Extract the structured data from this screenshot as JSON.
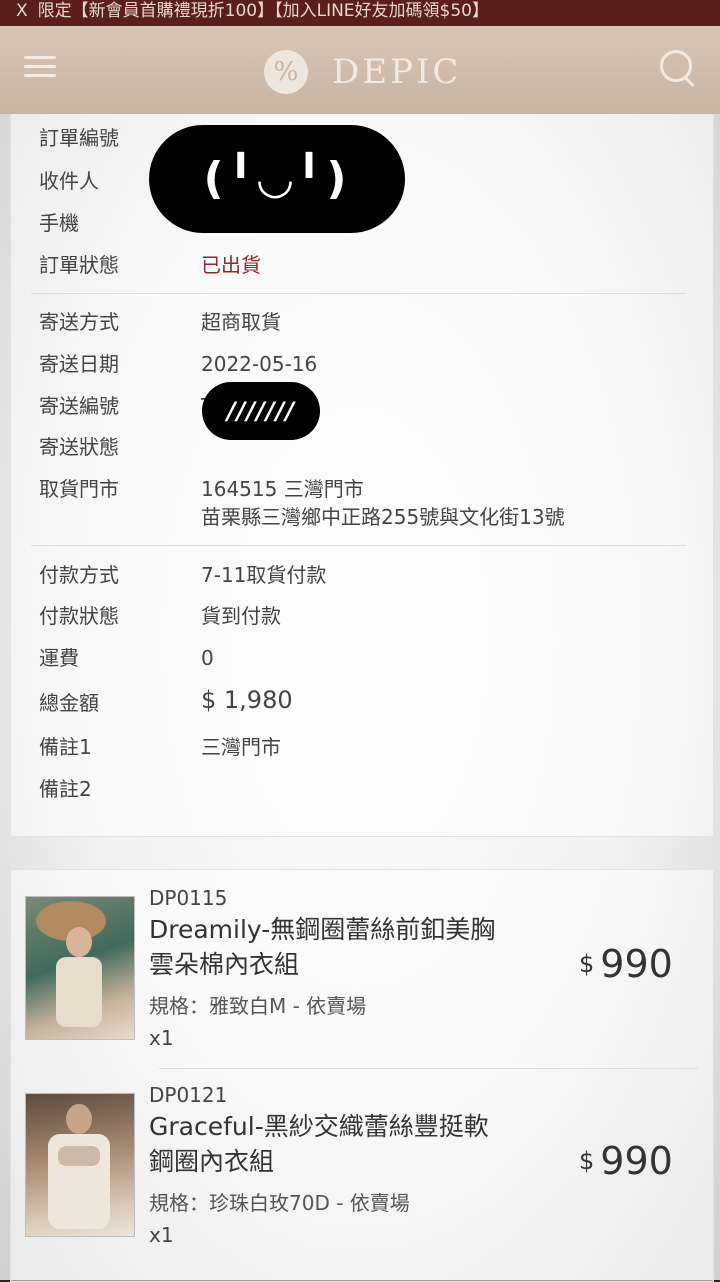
{
  "banner": {
    "close": "X",
    "text": "限定【新會員首購禮現折100】【加入LINE好友加碼領$50】"
  },
  "header": {
    "brand": "DEPIC",
    "logo_mark": "%",
    "icons": [
      "menu-icon",
      "search-icon"
    ]
  },
  "order": {
    "order_no_label": "訂單編號",
    "recipient_label": "收件人",
    "phone_label": "手機",
    "status_label": "訂單狀態",
    "status_value": "已出貨",
    "redaction_face": "(╹◡╹)",
    "shipping_method_label": "寄送方式",
    "shipping_method_value": "超商取貨",
    "shipping_date_label": "寄送日期",
    "shipping_date_value": "2022-05-16",
    "shipping_no_label": "寄送編號",
    "shipping_no_prefix": "T",
    "redaction_slashes": "///////",
    "shipping_status_label": "寄送狀態",
    "pickup_store_label": "取貨門市",
    "pickup_store_line1": "164515 三灣門市",
    "pickup_store_line2": "苗栗縣三灣鄉中正路255號與文化街13號",
    "payment_method_label": "付款方式",
    "payment_method_value": "7-11取貨付款",
    "payment_status_label": "付款狀態",
    "payment_status_value": "貨到付款",
    "shipping_fee_label": "運費",
    "shipping_fee_value": "0",
    "total_label": "總金額",
    "total_value": "$ 1,980",
    "note1_label": "備註1",
    "note1_value": "三灣門市",
    "note2_label": "備註2"
  },
  "items": [
    {
      "sku": "DP0115",
      "name_line1": "Dreamily-無鋼圈蕾絲前釦美胸",
      "name_line2": "雲朵棉內衣組",
      "spec": "規格：雅致白M - 依賣場",
      "qty": "x1",
      "currency": "$",
      "price": "990"
    },
    {
      "sku": "DP0121",
      "name_line1": "Graceful-黑紗交織蕾絲豐挺軟",
      "name_line2": "鋼圈內衣組",
      "spec": "規格：珍珠白玫70D - 依賣場",
      "qty": "x1",
      "currency": "$",
      "price": "990"
    }
  ],
  "colors": {
    "banner_bg": "#5a1f1c",
    "header_bg": "#d8c6b6",
    "status_red": "#8b2a2a"
  }
}
